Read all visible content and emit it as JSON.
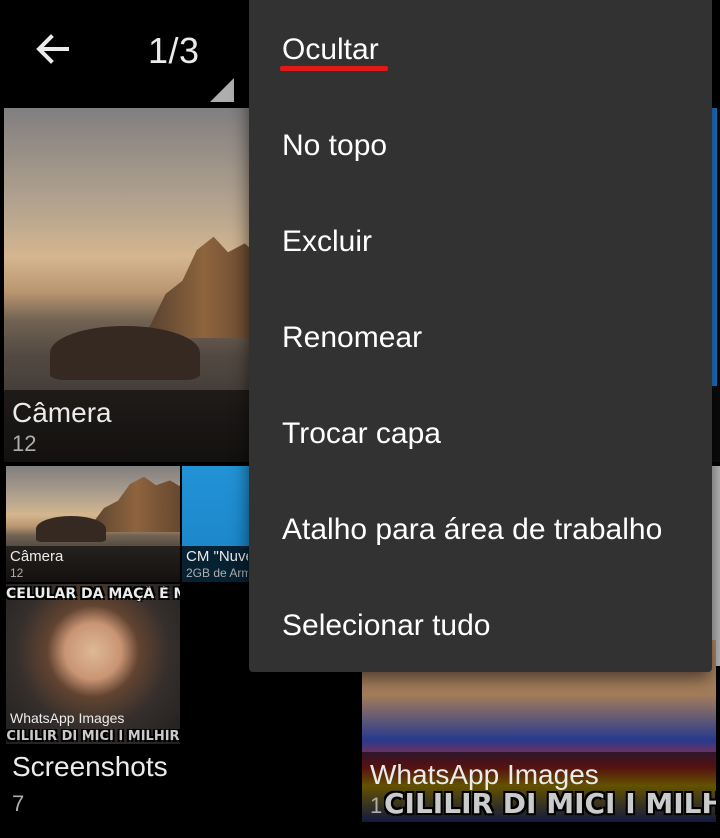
{
  "header": {
    "back_icon": "arrow-left-icon",
    "counter": "1/3"
  },
  "albums": {
    "camera_big": {
      "name": "Câmera",
      "count": "12"
    },
    "camera_small": {
      "name": "Câmera",
      "count": "12"
    },
    "cm_small": {
      "name": "CM \"Nuve",
      "count": "2GB de Arm"
    },
    "whatsapp_small": {
      "name": "WhatsApp Images",
      "meme_top": "CELULAR DA MAÇÃ É MELHOR",
      "meme_bottom": "CILILIR DI MICI I MILHIR"
    },
    "screenshots": {
      "name": "Screenshots",
      "count": "7"
    },
    "whatsapp_big": {
      "name": "WhatsApp Images",
      "count": "1",
      "meme_bottom": "CILILIR DI MICI I MILHIR"
    }
  },
  "menu": {
    "items": [
      {
        "label": "Ocultar"
      },
      {
        "label": "No topo"
      },
      {
        "label": "Excluir"
      },
      {
        "label": "Renomear"
      },
      {
        "label": "Trocar capa"
      },
      {
        "label": "Atalho para área de trabalho"
      },
      {
        "label": "Selecionar tudo"
      }
    ],
    "highlight_color": "#e31919"
  },
  "colors": {
    "menu_bg": "#323232",
    "accent_blue": "#1e88e5"
  }
}
